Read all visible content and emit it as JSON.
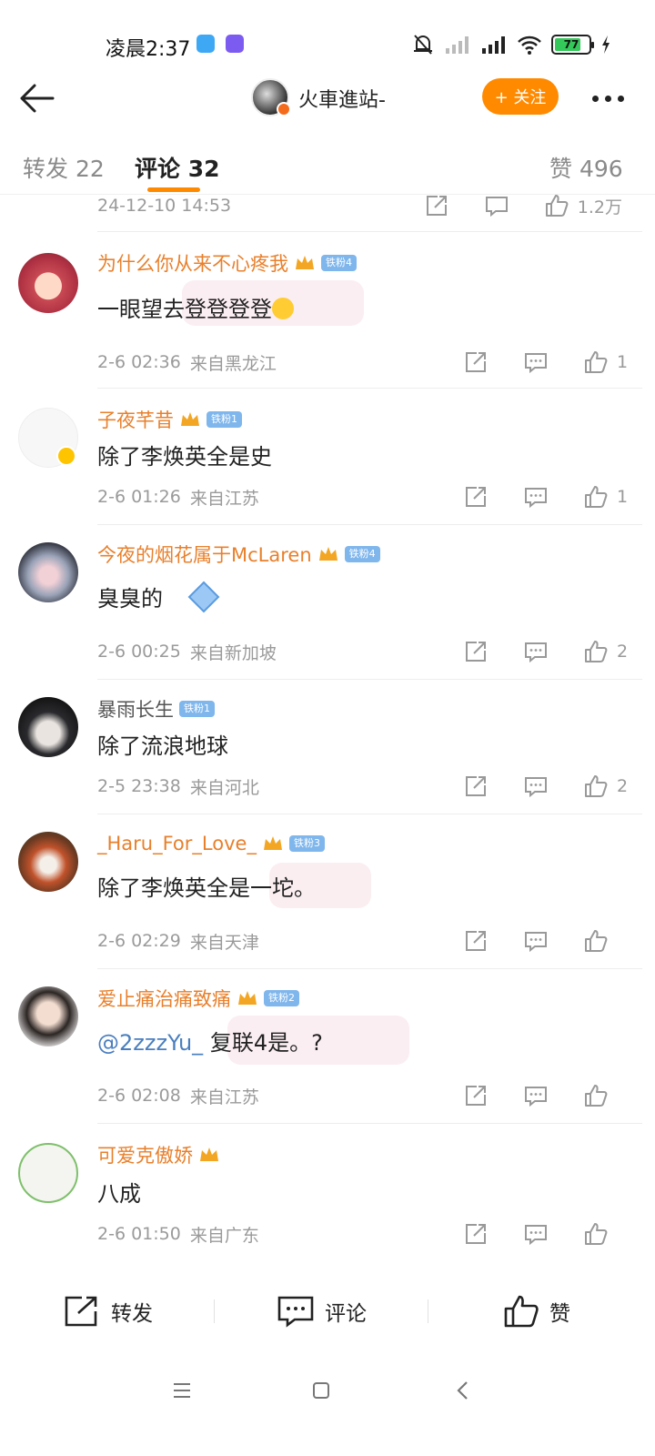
{
  "status_bar": {
    "time": "凌晨2:37",
    "battery_level": "77",
    "icons": [
      "app-badge-blue-icon",
      "shield-app-icon",
      "silent-bell-icon",
      "signal-weak-icon",
      "signal-strong-icon",
      "wifi-icon",
      "battery-icon",
      "charging-icon"
    ]
  },
  "header": {
    "back_icon": "arrow-left-icon",
    "poster_name": "火車進站-",
    "follow_label": "+ 关注",
    "more_icon": "more-dots-icon",
    "accent_color": "#ff8a00"
  },
  "tabs": [
    {
      "label": "转发 22",
      "active": false
    },
    {
      "label": "评论 32",
      "active": true
    },
    {
      "label": "赞 496",
      "active": false
    }
  ],
  "top_partial": {
    "time": "24-12-10 14:53",
    "likes": "1.2万"
  },
  "comments": [
    {
      "username": "为什么你从来不心疼我",
      "fan_badge": "铁粉4",
      "text": "一眼望去登登登登",
      "time": "2-6 02:36",
      "location": "来自黑龙江",
      "likes": "1"
    },
    {
      "username": "子夜芊昔",
      "fan_badge": "铁粉1",
      "text": "除了李焕英全是史",
      "time": "2-6 01:26",
      "location": "来自江苏",
      "likes": "1"
    },
    {
      "username": "今夜的烟花属于McLaren",
      "fan_badge": "铁粉4",
      "text": "臭臭的",
      "time": "2-6 00:25",
      "location": "来自新加坡",
      "likes": "2"
    },
    {
      "username": "暴雨长生",
      "fan_badge": "铁粉1",
      "text": "除了流浪地球",
      "time": "2-5 23:38",
      "location": "来自河北",
      "likes": "2"
    },
    {
      "username": "_Haru_For_Love_",
      "fan_badge": "铁粉3",
      "text": "除了李焕英全是一坨。",
      "time": "2-6 02:29",
      "location": "来自天津",
      "likes": ""
    },
    {
      "username": "爱止痛治痛致痛",
      "fan_badge": "铁粉2",
      "mention": "@2zzzYu_",
      "text": " 复联4是。?",
      "time": "2-6 02:08",
      "location": "来自江苏",
      "likes": ""
    },
    {
      "username": "可爱克傲娇",
      "fan_badge": "",
      "text": "八成",
      "time": "2-6 01:50",
      "location": "来自广东",
      "likes": ""
    }
  ],
  "bottom_bar": {
    "repost_label": "转发",
    "comment_label": "评论",
    "like_label": "赞"
  },
  "nav": {
    "icons": [
      "menu-icon",
      "home-square-icon",
      "back-chevron-icon"
    ]
  }
}
